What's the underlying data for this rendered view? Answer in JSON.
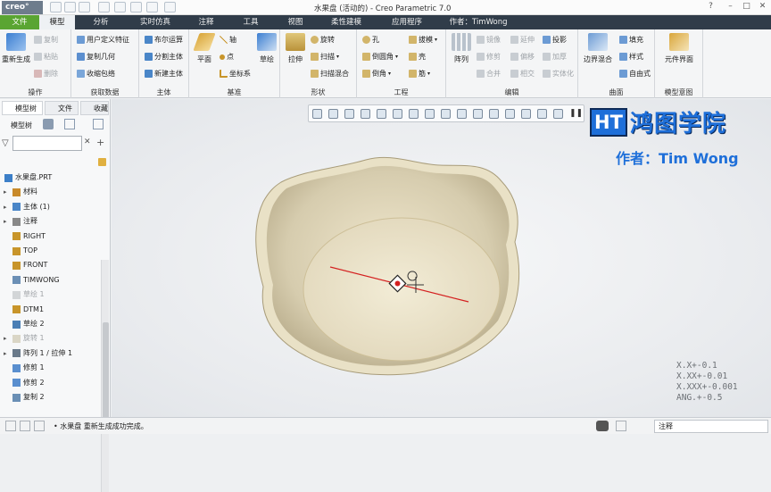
{
  "app": {
    "logo": "creo°",
    "title": "水果盘 (活动的) - Creo Parametric 7.0"
  },
  "tabs": [
    "文件",
    "模型",
    "分析",
    "实时仿真",
    "注释",
    "工具",
    "视图",
    "柔性建模",
    "应用程序"
  ],
  "author_tab": "作者：TimWong",
  "ribbon": {
    "operations": {
      "label": "操作",
      "regen": "重新生成",
      "copy": "复制",
      "paste": "粘贴",
      "delete": "删除"
    },
    "getdata": {
      "label": "获取数据",
      "udf": "用户定义特征",
      "copy_geom": "复制几何",
      "shrinkwrap": "收缩包络"
    },
    "body": {
      "label": "主体",
      "boolean": "布尔运算",
      "split": "分割主体",
      "new": "新建主体"
    },
    "datum": {
      "label": "基准",
      "plane": "平面",
      "axis": "轴",
      "point": "点",
      "csys": "坐标系",
      "sketch": "草绘"
    },
    "shapes": {
      "label": "形状",
      "extrude": "拉伸",
      "revolve": "旋转",
      "sweep": "扫描",
      "swept_blend": "扫描混合"
    },
    "engineering": {
      "label": "工程",
      "hole": "孔",
      "round": "倒圆角",
      "chamfer": "倒角",
      "draft": "拔模",
      "shell": "壳",
      "rib": "筋"
    },
    "editing": {
      "label": "编辑",
      "pattern": "阵列",
      "mirror": "镜像",
      "trim": "修剪",
      "merge": "合并",
      "extend": "延伸",
      "offset": "偏移",
      "intersect": "相交",
      "project": "投影",
      "thicken": "加厚",
      "solidify": "实体化"
    },
    "surfaces": {
      "label": "曲面",
      "boundary": "边界混合",
      "fill": "填充",
      "style": "样式",
      "freestyle": "自由式"
    },
    "intent": {
      "label": "模型意图",
      "component": "元件界面"
    }
  },
  "left_panel": {
    "tab_model_tree": "模型树",
    "tab_files": "文件",
    "tab_favorites": "收藏",
    "header": "模型树",
    "tree": [
      {
        "label": "水果盘.PRT",
        "dim": false,
        "expand": false
      },
      {
        "label": "材料",
        "dim": false,
        "expand": true
      },
      {
        "label": "主体 (1)",
        "dim": false,
        "expand": true
      },
      {
        "label": "注释",
        "dim": false,
        "expand": true
      },
      {
        "label": "RIGHT",
        "dim": false,
        "expand": false
      },
      {
        "label": "TOP",
        "dim": false,
        "expand": false
      },
      {
        "label": "FRONT",
        "dim": false,
        "expand": false
      },
      {
        "label": "TIMWONG",
        "dim": false,
        "expand": false
      },
      {
        "label": "草绘 1",
        "dim": true,
        "expand": false
      },
      {
        "label": "DTM1",
        "dim": false,
        "expand": false
      },
      {
        "label": "草绘 2",
        "dim": false,
        "expand": false
      },
      {
        "label": "旋转 1",
        "dim": true,
        "expand": true
      },
      {
        "label": "阵列 1 / 拉伸 1",
        "dim": false,
        "expand": true
      },
      {
        "label": "修剪 1",
        "dim": false,
        "expand": false
      },
      {
        "label": "修剪 2",
        "dim": false,
        "expand": false
      },
      {
        "label": "复制 2",
        "dim": false,
        "expand": false
      }
    ]
  },
  "watermark": {
    "brand": "鸿图学院",
    "logo": "HT",
    "author": "作者：Tim Wong"
  },
  "tolerances": "X.X+-0.1\nX.XX+-0.01\nX.XXX+-0.001\nANG.+-0.5",
  "status": {
    "message": "• 水果盘 重新生成成功完成。",
    "filter": "注释"
  },
  "colors": {
    "file_tab": "#5aa532",
    "tab_bar": "#303c49",
    "brand": "#1e6fd9",
    "dish_outer": "#d8cfb4",
    "dish_inner": "#ece4cc"
  }
}
